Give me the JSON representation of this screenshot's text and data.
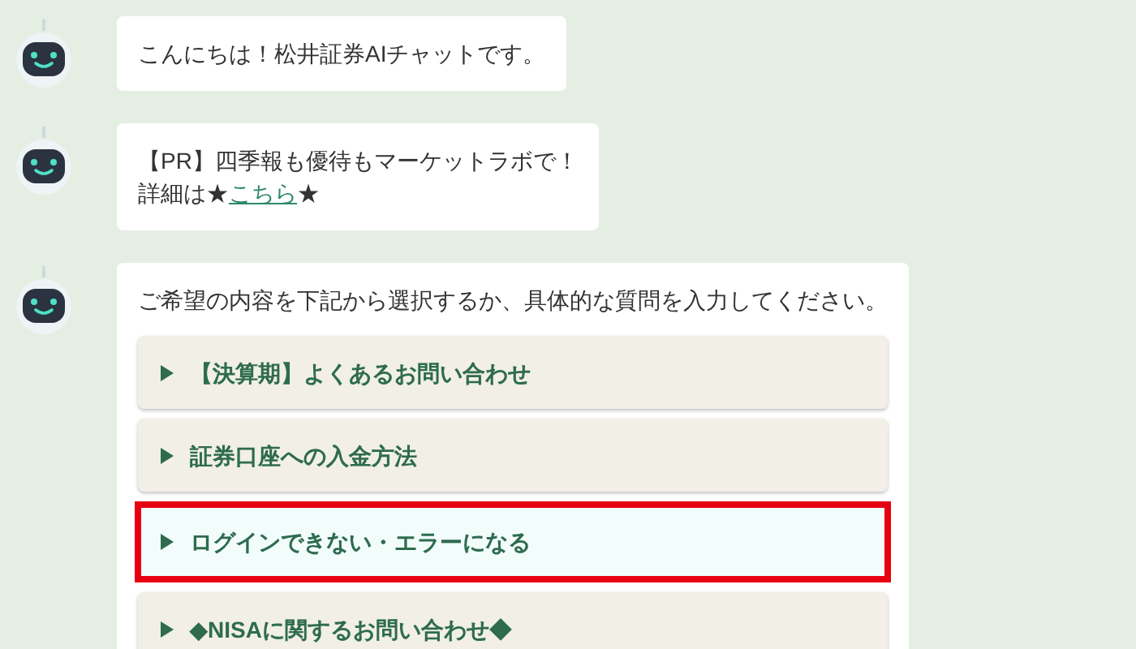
{
  "messages": [
    {
      "kind": "text",
      "lines": [
        "こんにちは！松井証券AIチャットです。"
      ]
    },
    {
      "kind": "link",
      "lines": [
        "【PR】四季報も優待もマーケットラボで！"
      ],
      "before_link": "詳細は★",
      "link": "こちら",
      "after_link": "★"
    },
    {
      "kind": "options",
      "lines": [
        "ご希望の内容を下記から選択するか、具体的な質問を入力してください。"
      ],
      "options": [
        {
          "label": "【決算期】よくあるお問い合わせ",
          "highlighted": false
        },
        {
          "label": "証券口座への入金方法",
          "highlighted": false
        },
        {
          "label": "ログインできない・エラーになる",
          "highlighted": true
        },
        {
          "label": "◆NISAに関するお問い合わせ◆",
          "highlighted": false
        }
      ]
    }
  ]
}
